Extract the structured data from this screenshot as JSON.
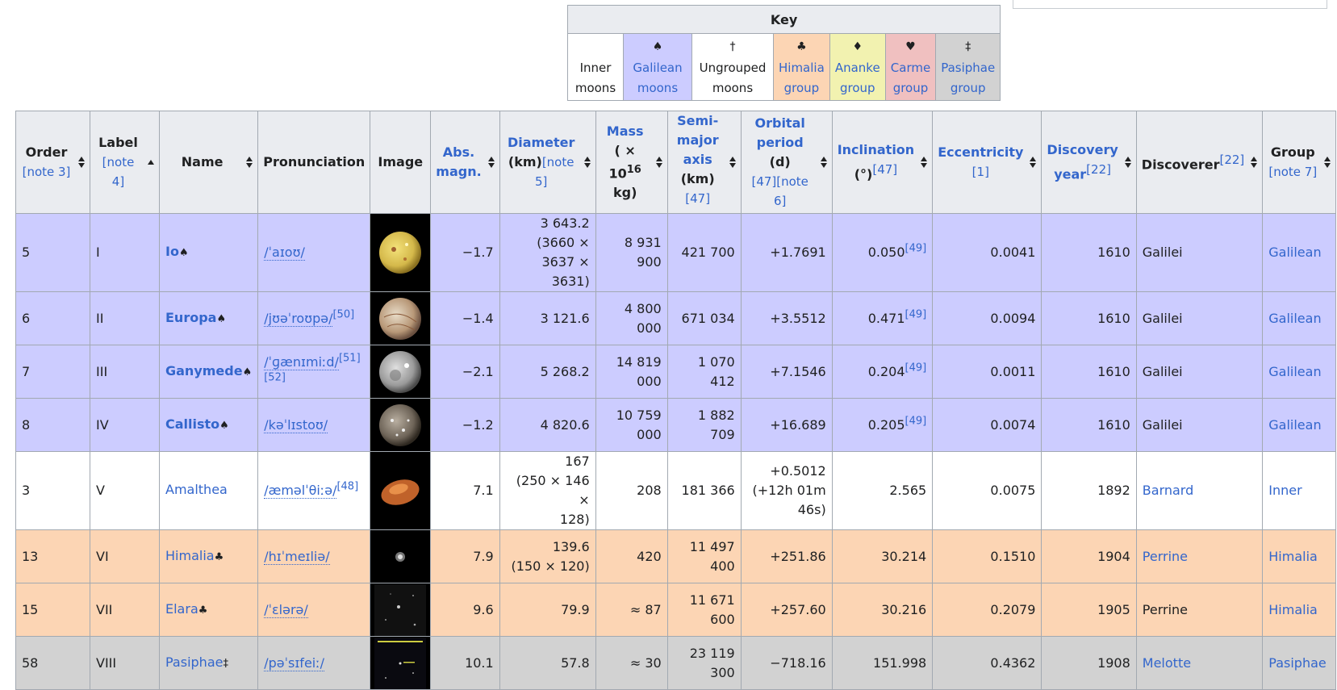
{
  "key": {
    "title": "Key",
    "cells": [
      {
        "symbol": "",
        "line1": "Inner",
        "line2": "moons",
        "link": false
      },
      {
        "symbol": "♠",
        "line1": "Galilean",
        "line2": "moons",
        "link": true
      },
      {
        "symbol": "†",
        "line1": "Ungrouped",
        "line2": "moons",
        "link": false
      },
      {
        "symbol": "♣",
        "line1": "Himalia",
        "line2": "group",
        "link": true
      },
      {
        "symbol": "♦",
        "line1": "Ananke",
        "line2": "group",
        "link": true
      },
      {
        "symbol": "♥",
        "line1": "Carme",
        "line2": "group",
        "link": true
      },
      {
        "symbol": "‡",
        "line1": "Pasiphae",
        "line2": "group",
        "link": true
      }
    ]
  },
  "headers": {
    "order": {
      "label": "Order",
      "sub": "[note 3]"
    },
    "label": {
      "label": "Label",
      "sub": "[note 4]"
    },
    "name": {
      "label": "Name"
    },
    "pronunciation": {
      "label": "Pronunciation"
    },
    "image": {
      "label": "Image"
    },
    "absmag": {
      "line1": "Abs.",
      "line2": "magn."
    },
    "diameter": {
      "label": "Diameter",
      "unit": "(km)",
      "sub": "[note 5]"
    },
    "mass": {
      "label": "Mass",
      "line2a": "( × 10",
      "exp": "16",
      "line3": "kg)"
    },
    "semimajor": {
      "line1": "Semi-",
      "line2": "major",
      "line3": "axis",
      "unit": "(km)",
      "sub": "[47]"
    },
    "period": {
      "line1": "Orbital",
      "line2": "period",
      "unit": "(d)",
      "sub": "[47][note 6]"
    },
    "inclination": {
      "label": "Inclination",
      "unit": "(°)",
      "sub": "[47]"
    },
    "eccentricity": {
      "label": "Eccentricity",
      "sub": "[1]"
    },
    "discovery": {
      "line1": "Discovery",
      "line2": "year",
      "sub": "[22]"
    },
    "discoverer": {
      "label": "Discoverer",
      "sub": "[22]"
    },
    "group": {
      "label": "Group",
      "sub": "[note 7]"
    }
  },
  "rows": [
    {
      "cls": "gal",
      "order": "5",
      "label": "I",
      "name": "Io",
      "bold": true,
      "sym": "♠",
      "pron": "/ˈaɪoʊ/",
      "pron_ref": "",
      "img": "io",
      "absmag": "−1.7",
      "diam1": "3 643.2",
      "diam2": "(3660 × 3637 ×",
      "diam3": "3631)",
      "mass": "8 931 900",
      "axis": "421 700",
      "period1": "+1.7691",
      "period2": "",
      "period3": "",
      "incl": "0.050",
      "incl_ref": "[49]",
      "ecc": "0.0041",
      "year": "1610",
      "disc": "Galilei",
      "disc_link": false,
      "group": "Galilean"
    },
    {
      "cls": "gal",
      "order": "6",
      "label": "II",
      "name": "Europa",
      "bold": true,
      "sym": "♠",
      "pron": "/jʊəˈroʊpə/",
      "pron_ref": "[50]",
      "img": "europa",
      "absmag": "−1.4",
      "diam1": "3 121.6",
      "diam2": "",
      "diam3": "",
      "mass": "4 800 000",
      "axis": "671 034",
      "period1": "+3.5512",
      "period2": "",
      "period3": "",
      "incl": "0.471",
      "incl_ref": "[49]",
      "ecc": "0.0094",
      "year": "1610",
      "disc": "Galilei",
      "disc_link": false,
      "group": "Galilean"
    },
    {
      "cls": "gal",
      "order": "7",
      "label": "III",
      "name": "Ganymede",
      "bold": true,
      "sym": "♠",
      "pron": "/ˈɡænɪmiːd/",
      "pron_ref": "[51][52]",
      "img": "ganymede",
      "absmag": "−2.1",
      "diam1": "5 268.2",
      "diam2": "",
      "diam3": "",
      "mass": "14 819 000",
      "axis": "1 070 412",
      "period1": "+7.1546",
      "period2": "",
      "period3": "",
      "incl": "0.204",
      "incl_ref": "[49]",
      "ecc": "0.0011",
      "year": "1610",
      "disc": "Galilei",
      "disc_link": false,
      "group": "Galilean"
    },
    {
      "cls": "gal",
      "order": "8",
      "label": "IV",
      "name": "Callisto",
      "bold": true,
      "sym": "♠",
      "pron": "/kəˈlɪstoʊ/",
      "pron_ref": "",
      "img": "callisto",
      "absmag": "−1.2",
      "diam1": "4 820.6",
      "diam2": "",
      "diam3": "",
      "mass": "10 759 000",
      "axis": "1 882 709",
      "period1": "+16.689",
      "period2": "",
      "period3": "",
      "incl": "0.205",
      "incl_ref": "[49]",
      "ecc": "0.0074",
      "year": "1610",
      "disc": "Galilei",
      "disc_link": false,
      "group": "Galilean"
    },
    {
      "cls": "inn",
      "order": "3",
      "label": "V",
      "name": "Amalthea",
      "bold": false,
      "sym": "",
      "pron": "/æməlˈθiːə/",
      "pron_ref": "[48]",
      "img": "amalthea",
      "absmag": "7.1",
      "diam1": "167",
      "diam2": "(250 × 146 ×",
      "diam3": "128)",
      "mass": "208",
      "axis": "181 366",
      "period1": "+0.5012",
      "period2": "(+12h 01m",
      "period3": "46s)",
      "incl": "2.565",
      "incl_ref": "",
      "ecc": "0.0075",
      "year": "1892",
      "disc": "Barnard",
      "disc_link": true,
      "group": "Inner"
    },
    {
      "cls": "him",
      "order": "13",
      "label": "VI",
      "name": "Himalia",
      "bold": false,
      "sym": "♣",
      "pron": "/hɪˈmeɪliə/",
      "pron_ref": "",
      "img": "himalia",
      "absmag": "7.9",
      "diam1": "139.6",
      "diam2": "(150 × 120)",
      "diam3": "",
      "mass": "420",
      "axis": "11 497 400",
      "period1": "+251.86",
      "period2": "",
      "period3": "",
      "incl": "30.214",
      "incl_ref": "",
      "ecc": "0.1510",
      "year": "1904",
      "disc": "Perrine",
      "disc_link": true,
      "group": "Himalia"
    },
    {
      "cls": "him",
      "order": "15",
      "label": "VII",
      "name": "Elara",
      "bold": false,
      "sym": "♣",
      "pron": "/ˈɛlərə/",
      "pron_ref": "",
      "img": "elara",
      "absmag": "9.6",
      "diam1": "79.9",
      "diam2": "",
      "diam3": "",
      "mass": "≈ 87",
      "axis": "11 671 600",
      "period1": "+257.60",
      "period2": "",
      "period3": "",
      "incl": "30.216",
      "incl_ref": "",
      "ecc": "0.2079",
      "year": "1905",
      "disc": "Perrine",
      "disc_link": false,
      "group": "Himalia"
    },
    {
      "cls": "pas",
      "order": "58",
      "label": "VIII",
      "name": "Pasiphae",
      "bold": false,
      "sym": "‡",
      "pron": "/pəˈsɪfeiː/",
      "pron_ref": "",
      "img": "pasiphae",
      "absmag": "10.1",
      "diam1": "57.8",
      "diam2": "",
      "diam3": "",
      "mass": "≈ 30",
      "axis": "23 119 300",
      "period1": "−718.16",
      "period2": "",
      "period3": "",
      "incl": "151.998",
      "incl_ref": "",
      "ecc": "0.4362",
      "year": "1908",
      "disc": "Melotte",
      "disc_link": true,
      "group": "Pasiphae"
    }
  ],
  "colors": {
    "galilean": "#ccccff",
    "inner": "#ffffff",
    "himalia": "#fcd5b4",
    "ananke": "#f2f2b0",
    "carme": "#f0c0c0",
    "pasiphae": "#d2d2d2",
    "link": "#3366cc",
    "header": "#eaecf0"
  }
}
